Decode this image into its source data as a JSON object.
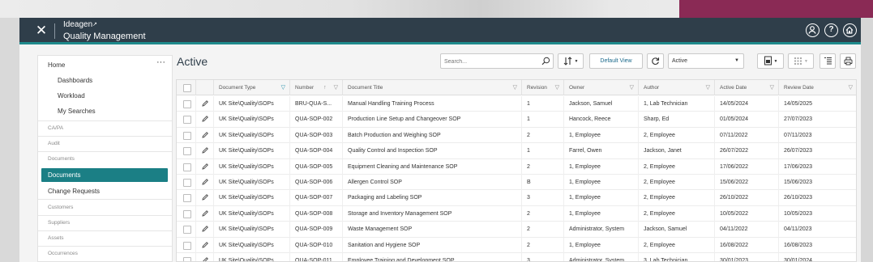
{
  "header": {
    "brand": "Ideagen",
    "app_title": "Quality Management"
  },
  "sidebar": {
    "home": "Home",
    "more": "···",
    "sub_items": [
      "Dashboards",
      "Workload",
      "My Searches"
    ],
    "groups": [
      "CA/PA",
      "Audit",
      "Documents",
      "Customers",
      "Suppliers",
      "Assets",
      "Occurrences"
    ],
    "active_item": "Documents",
    "change_requests": "Change Requests"
  },
  "toolbar": {
    "page_title": "Active",
    "search_placeholder": "Search...",
    "default_view_label": "Default View",
    "status_value": "Active"
  },
  "grid": {
    "columns": [
      "Document Type",
      "Number",
      "Document Title",
      "Revision",
      "Owner",
      "Author",
      "Active Date",
      "Review Date"
    ],
    "rows": [
      [
        "UK Site\\Quality\\SOPs",
        "BRU-QUA-S...",
        "Manual Handling Training Process",
        "1",
        "Jackson, Samuel",
        "1, Lab Technician",
        "14/05/2024",
        "14/05/2025"
      ],
      [
        "UK Site\\Quality\\SOPs",
        "QUA-SOP-002",
        "Production Line Setup and Changeover SOP",
        "1",
        "Hancock, Reece",
        "Sharp, Ed",
        "01/05/2024",
        "27/07/2023"
      ],
      [
        "UK Site\\Quality\\SOPs",
        "QUA-SOP-003",
        "Batch Production and Weighing SOP",
        "2",
        "1, Employee",
        "2, Employee",
        "07/11/2022",
        "07/11/2023"
      ],
      [
        "UK Site\\Quality\\SOPs",
        "QUA-SOP-004",
        "Quality Control and Inspection SOP",
        "1",
        "Farrel, Owen",
        "Jackson, Janet",
        "26/07/2022",
        "26/07/2023"
      ],
      [
        "UK Site\\Quality\\SOPs",
        "QUA-SOP-005",
        "Equipment Cleaning and Maintenance SOP",
        "2",
        "1, Employee",
        "2, Employee",
        "17/06/2022",
        "17/06/2023"
      ],
      [
        "UK Site\\Quality\\SOPs",
        "QUA-SOP-006",
        "Allergen Control SOP",
        "B",
        "1, Employee",
        "2, Employee",
        "15/06/2022",
        "15/06/2023"
      ],
      [
        "UK Site\\Quality\\SOPs",
        "QUA-SOP-007",
        "Packaging and Labeling SOP",
        "3",
        "1, Employee",
        "2, Employee",
        "26/10/2022",
        "26/10/2023"
      ],
      [
        "UK Site\\Quality\\SOPs",
        "QUA-SOP-008",
        "Storage and Inventory Management SOP",
        "2",
        "1, Employee",
        "2, Employee",
        "10/05/2022",
        "10/05/2023"
      ],
      [
        "UK Site\\Quality\\SOPs",
        "QUA-SOP-009",
        "Waste Management SOP",
        "2",
        "Administrator, System",
        "Jackson, Samuel",
        "04/11/2022",
        "04/11/2023"
      ],
      [
        "UK Site\\Quality\\SOPs",
        "QUA-SOP-010",
        "Sanitation and Hygiene SOP",
        "2",
        "1, Employee",
        "2, Employee",
        "16/08/2022",
        "16/08/2023"
      ],
      [
        "UK Site\\Quality\\SOPs",
        "QUA-SOP-011",
        "Employee Training and Development SOP",
        "3",
        "Administrator, System",
        "3, Lab Technician",
        "30/01/2023",
        "30/01/2024"
      ]
    ]
  },
  "colors": {
    "header_bg": "#2f3e4a",
    "accent_teal": "#1b7f85",
    "filter_active": "#1b8aa5"
  },
  "icons": [
    "close-icon",
    "user-icon",
    "help-icon",
    "home-icon",
    "search-icon",
    "sort-icon",
    "refresh-icon",
    "export-icon",
    "columns-icon",
    "list-icon",
    "print-icon",
    "filter-icon",
    "pencil-icon"
  ]
}
